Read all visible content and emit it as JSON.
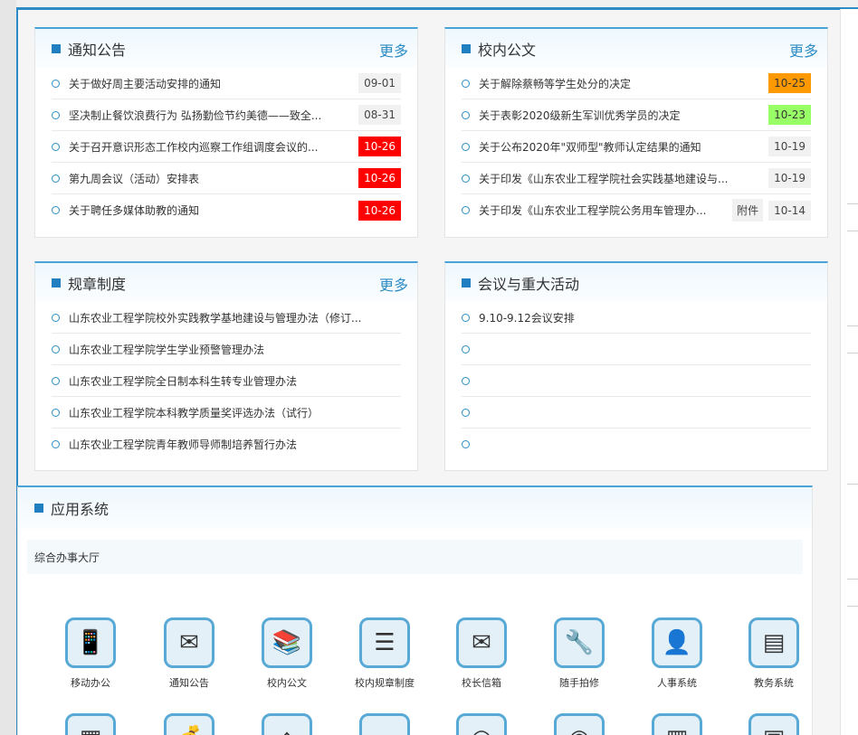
{
  "notice": {
    "title": "通知公告",
    "more": "更多",
    "items": [
      {
        "text": "关于做好周主要活动安排的通知",
        "date": "09-01",
        "highlight": "gray"
      },
      {
        "text": "坚决制止餐饮浪费行为 弘扬勤俭节约美德——致全...",
        "date": "08-31",
        "highlight": "gray"
      },
      {
        "text": "关于召开意识形态工作校内巡察工作组调度会议的...",
        "date": "10-26",
        "highlight": "red"
      },
      {
        "text": "第九周会议（活动）安排表",
        "date": "10-26",
        "highlight": "red"
      },
      {
        "text": "关于聘任多媒体助教的通知",
        "date": "10-26",
        "highlight": "red"
      }
    ]
  },
  "documents": {
    "title": "校内公文",
    "more": "更多",
    "items": [
      {
        "text": "关于解除蔡畅等学生处分的决定",
        "date": "10-25",
        "highlight": "orange"
      },
      {
        "text": "关于表彰2020级新生军训优秀学员的决定",
        "date": "10-23",
        "highlight": "green"
      },
      {
        "text": "关于公布2020年\"双师型\"教师认定结果的通知",
        "date": "10-19",
        "highlight": "gray"
      },
      {
        "text": "关于印发《山东农业工程学院社会实践基地建设与...",
        "date": "10-19",
        "highlight": "gray"
      },
      {
        "text": "关于印发《山东农业工程学院公务用车管理办...",
        "attachment": "附件",
        "date": "10-14",
        "highlight": "gray"
      }
    ]
  },
  "rules": {
    "title": "规章制度",
    "more": "更多",
    "items": [
      {
        "text": "山东农业工程学院校外实践教学基地建设与管理办法（修订..."
      },
      {
        "text": "山东农业工程学院学生学业预警管理办法"
      },
      {
        "text": "山东农业工程学院全日制本科生转专业管理办法"
      },
      {
        "text": "山东农业工程学院本科教学质量奖评选办法（试行）"
      },
      {
        "text": "山东农业工程学院青年教师导师制培养暂行办法"
      }
    ]
  },
  "meetings": {
    "title": "会议与重大活动",
    "items": [
      {
        "text": "9.10-9.12会议安排"
      },
      {
        "text": ""
      },
      {
        "text": ""
      },
      {
        "text": ""
      },
      {
        "text": ""
      }
    ]
  },
  "apps": {
    "title": "应用系统",
    "section": "综合办事大厅",
    "row1": [
      {
        "label": "移动办公",
        "icon": "mobile-office-icon",
        "glyph": "📱"
      },
      {
        "label": "通知公告",
        "icon": "notice-envelope-icon",
        "glyph": "✉"
      },
      {
        "label": "校内公文",
        "icon": "documents-books-icon",
        "glyph": "📚"
      },
      {
        "label": "校内规章制度",
        "icon": "rules-list-icon",
        "glyph": "☰"
      },
      {
        "label": "校长信箱",
        "icon": "mailbox-icon",
        "glyph": "✉"
      },
      {
        "label": "随手拍修",
        "icon": "repair-tools-icon",
        "glyph": "🔧"
      },
      {
        "label": "人事系统",
        "icon": "personnel-icon",
        "glyph": "👤"
      },
      {
        "label": "教务系统",
        "icon": "academic-icon",
        "glyph": "▤"
      }
    ],
    "row2": [
      {
        "icon": "app-icon-9",
        "glyph": "▦"
      },
      {
        "icon": "app-icon-10",
        "glyph": "💰"
      },
      {
        "icon": "app-icon-11",
        "glyph": "⌂"
      },
      {
        "icon": "app-icon-12",
        "glyph": "▭"
      },
      {
        "icon": "app-icon-13",
        "glyph": "◎"
      },
      {
        "icon": "app-icon-14",
        "glyph": "◉"
      },
      {
        "icon": "app-icon-15",
        "glyph": "▥"
      },
      {
        "icon": "app-icon-16",
        "glyph": "▣"
      }
    ]
  }
}
